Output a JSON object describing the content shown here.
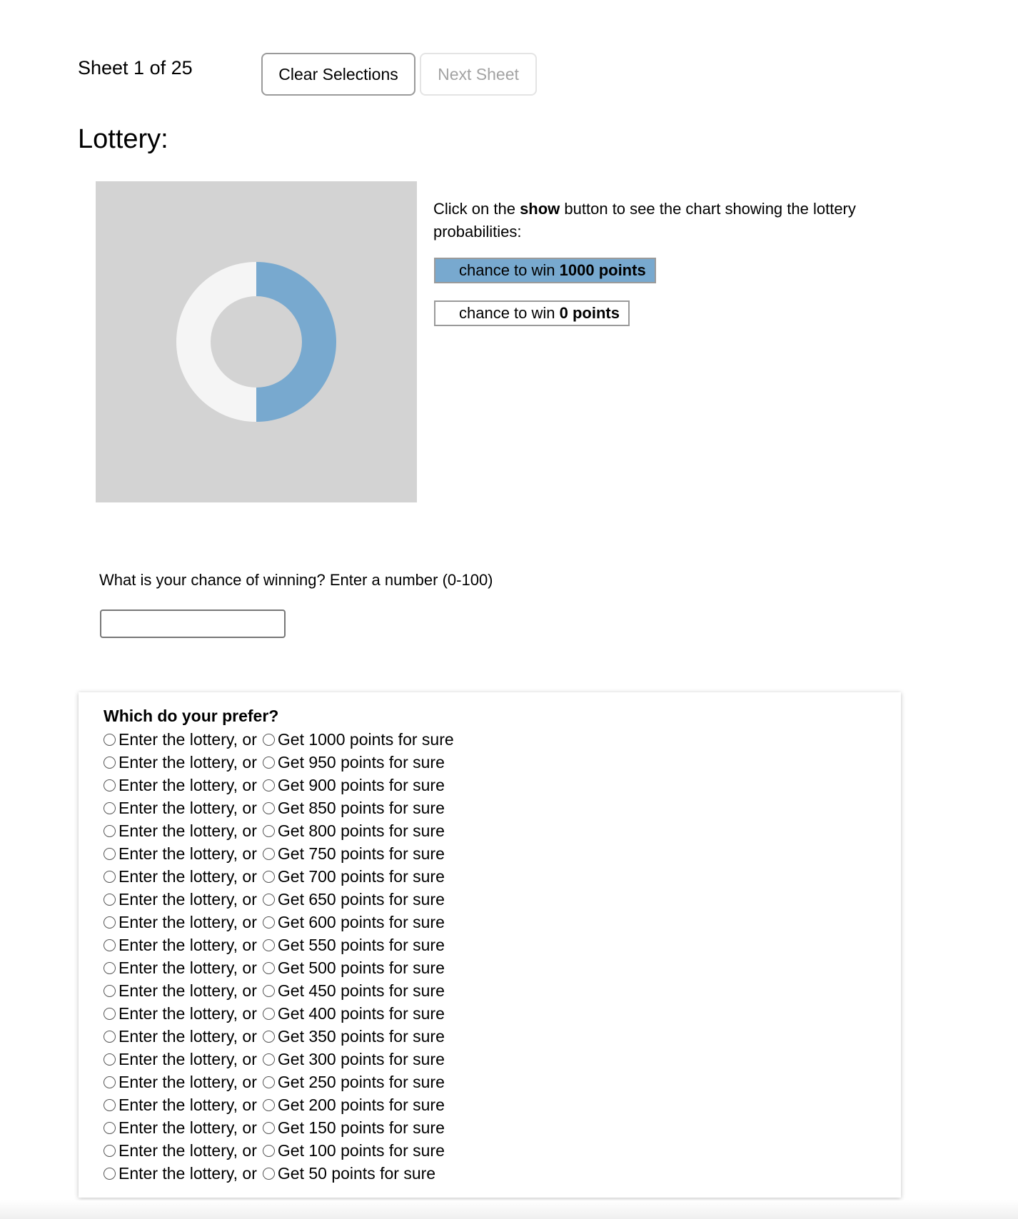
{
  "header": {
    "sheet_label": "Sheet 1 of 25",
    "clear_label": "Clear Selections",
    "next_label": "Next Sheet"
  },
  "section_title": "Lottery:",
  "instructions": {
    "prefix": "Click on the ",
    "bold_word": "show",
    "suffix": " button to see the chart showing the lottery probabilities:"
  },
  "legend": [
    {
      "prefix": "chance to win ",
      "bold": "1000 points",
      "color": "#78a9cf"
    },
    {
      "prefix": "chance to win ",
      "bold": "0 points",
      "color": "#ffffff"
    }
  ],
  "chart": {
    "win_fraction": 0.5,
    "win_color": "#78a9cf",
    "lose_color": "#f5f5f5",
    "background": "#d3d3d3"
  },
  "question": {
    "label": "What is your chance of winning? Enter a number (0-100)",
    "value": ""
  },
  "preference": {
    "title": "Which do your prefer?",
    "rows": [
      {
        "lottery": "Enter the lottery, or",
        "sure": "Get 1000 points for sure"
      },
      {
        "lottery": "Enter the lottery, or",
        "sure": "Get 950 points for sure"
      },
      {
        "lottery": "Enter the lottery, or",
        "sure": "Get 900 points for sure"
      },
      {
        "lottery": "Enter the lottery, or",
        "sure": "Get 850 points for sure"
      },
      {
        "lottery": "Enter the lottery, or",
        "sure": "Get 800 points for sure"
      },
      {
        "lottery": "Enter the lottery, or",
        "sure": "Get 750 points for sure"
      },
      {
        "lottery": "Enter the lottery, or",
        "sure": "Get 700 points for sure"
      },
      {
        "lottery": "Enter the lottery, or",
        "sure": "Get 650 points for sure"
      },
      {
        "lottery": "Enter the lottery, or",
        "sure": "Get 600 points for sure"
      },
      {
        "lottery": "Enter the lottery, or",
        "sure": "Get 550 points for sure"
      },
      {
        "lottery": "Enter the lottery, or",
        "sure": "Get 500 points for sure"
      },
      {
        "lottery": "Enter the lottery, or",
        "sure": "Get 450 points for sure"
      },
      {
        "lottery": "Enter the lottery, or",
        "sure": "Get 400 points for sure"
      },
      {
        "lottery": "Enter the lottery, or",
        "sure": "Get 350 points for sure"
      },
      {
        "lottery": "Enter the lottery, or",
        "sure": "Get 300 points for sure"
      },
      {
        "lottery": "Enter the lottery, or",
        "sure": "Get 250 points for sure"
      },
      {
        "lottery": "Enter the lottery, or",
        "sure": "Get 200 points for sure"
      },
      {
        "lottery": "Enter the lottery, or",
        "sure": "Get 150 points for sure"
      },
      {
        "lottery": "Enter the lottery, or",
        "sure": "Get 100 points for sure"
      },
      {
        "lottery": "Enter the lottery, or",
        "sure": "Get 50 points for sure"
      }
    ]
  }
}
